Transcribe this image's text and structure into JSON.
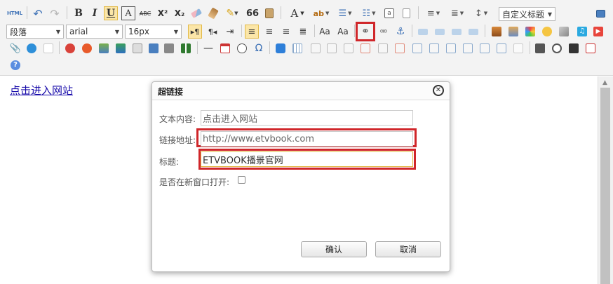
{
  "toolbar": {
    "html_label": "HTML",
    "bold": "B",
    "italic": "I",
    "underline": "U",
    "font_border": "A",
    "strikethrough": "ABC",
    "superscript": "X²",
    "subscript": "X₂",
    "quote": "66",
    "font_color": "A",
    "paragraph_select": "段落",
    "font_family_select": "arial",
    "font_size_select": "16px",
    "custom_title_select": "自定义标题",
    "omega": "Ω",
    "help": "?"
  },
  "content": {
    "link_text": "点击进入网站"
  },
  "dialog": {
    "title": "超链接",
    "text_label": "文本内容:",
    "text_value": "点击进入网站",
    "url_label": "链接地址:",
    "url_value": "http://www.etvbook.com",
    "title_label": "标题:",
    "title_value": "ETVBOOK播景官网",
    "new_window_label": "是否在新窗口打开:",
    "confirm_label": "确认",
    "cancel_label": "取消"
  },
  "colors": {
    "highlight": "#d0262a",
    "active_button": "#fbe6a8",
    "link": "#1a0dab"
  }
}
